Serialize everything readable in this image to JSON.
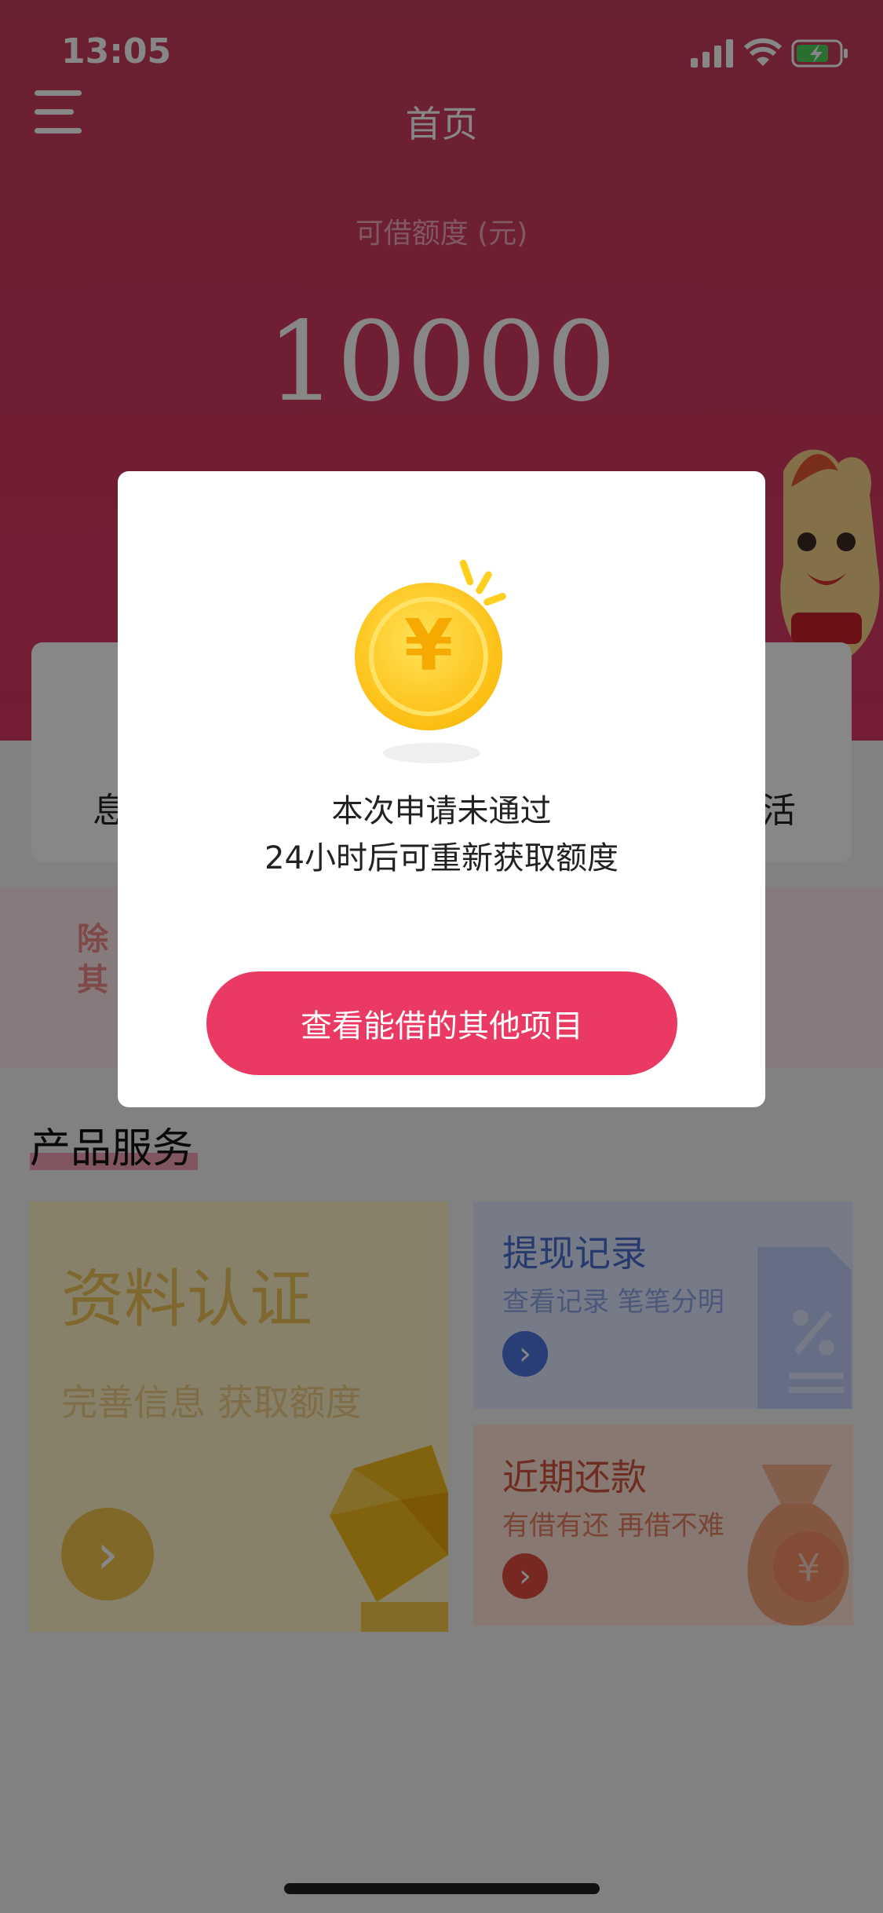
{
  "status_bar": {
    "time": "13:05"
  },
  "header": {
    "title": "首页"
  },
  "hero": {
    "limit_label": "可借额度 (元)",
    "limit_amount": "10000"
  },
  "cards": {
    "left_partial": "息",
    "right_partial": "活"
  },
  "banner": {
    "partial_text": "除\n其"
  },
  "section": {
    "title": "产品服务"
  },
  "tiles": {
    "verify": {
      "title": "资料认证",
      "subtitle": "完善信息 获取额度"
    },
    "withdraw": {
      "title": "提现记录",
      "subtitle": "查看记录 笔笔分明"
    },
    "repay": {
      "title": "近期还款",
      "subtitle": "有借有还 再借不难"
    }
  },
  "modal": {
    "line1": "本次申请未通过",
    "line2": "24小时后可重新获取额度",
    "button": "查看能借的其他项目",
    "coin_symbol": "¥"
  },
  "colors": {
    "brand": "#e8375f",
    "yellow": "#fcc419",
    "blue": "#4f73e0",
    "red": "#e14d3d"
  },
  "icons": [
    "menu-icon",
    "signal-icon",
    "wifi-icon",
    "battery-icon",
    "coin-icon",
    "chevron-right-icon"
  ]
}
